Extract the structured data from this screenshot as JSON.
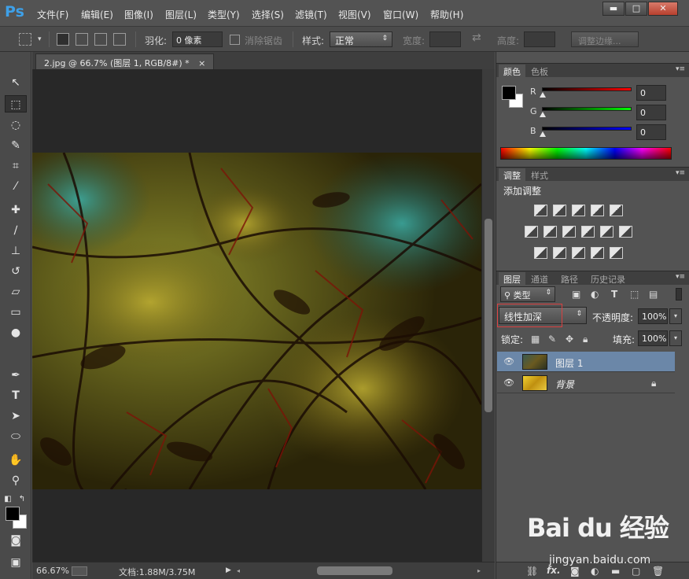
{
  "app": {
    "logo": "Ps",
    "menu": [
      "文件(F)",
      "编辑(E)",
      "图像(I)",
      "图层(L)",
      "类型(Y)",
      "选择(S)",
      "滤镜(T)",
      "视图(V)",
      "窗口(W)",
      "帮助(H)"
    ],
    "window_buttons": {
      "minimize": "▬",
      "maximize": "□",
      "close": "✕"
    }
  },
  "options": {
    "feather_label": "羽化:",
    "feather_value": "0 像素",
    "antialias_label": "消除锯齿",
    "style_label": "样式:",
    "style_value": "正常",
    "width_label": "宽度:",
    "height_label": "高度:",
    "refine_edge": "调整边缘..."
  },
  "document": {
    "tab_title": "2.jpg @ 66.7% (图层 1, RGB/8#) *",
    "tab_close": "×",
    "zoom": "66.67%",
    "doc_size": "文档:1.88M/3.75M"
  },
  "color_panel": {
    "tabs": [
      "颜色",
      "色板"
    ],
    "channels": [
      {
        "label": "R",
        "value": "0",
        "color": "#ff0000"
      },
      {
        "label": "G",
        "value": "0",
        "color": "#00cc00"
      },
      {
        "label": "B",
        "value": "0",
        "color": "#0000ff"
      }
    ]
  },
  "adjustments_panel": {
    "tabs": [
      "调整",
      "样式"
    ],
    "title": "添加调整"
  },
  "layers_panel": {
    "tabs": [
      "图层",
      "通道",
      "路径",
      "历史记录"
    ],
    "filter_label": "类型",
    "blend_mode": "线性加深",
    "opacity_label": "不透明度:",
    "opacity_value": "100%",
    "lock_label": "锁定:",
    "fill_label": "填充:",
    "fill_value": "100%",
    "layers": [
      {
        "name": "图层 1",
        "selected": true
      },
      {
        "name": "背景",
        "selected": false
      }
    ],
    "bottom_fx": "fx."
  },
  "watermark": {
    "logo": "Bai du 经验",
    "url": "jingyan.baidu.com"
  }
}
